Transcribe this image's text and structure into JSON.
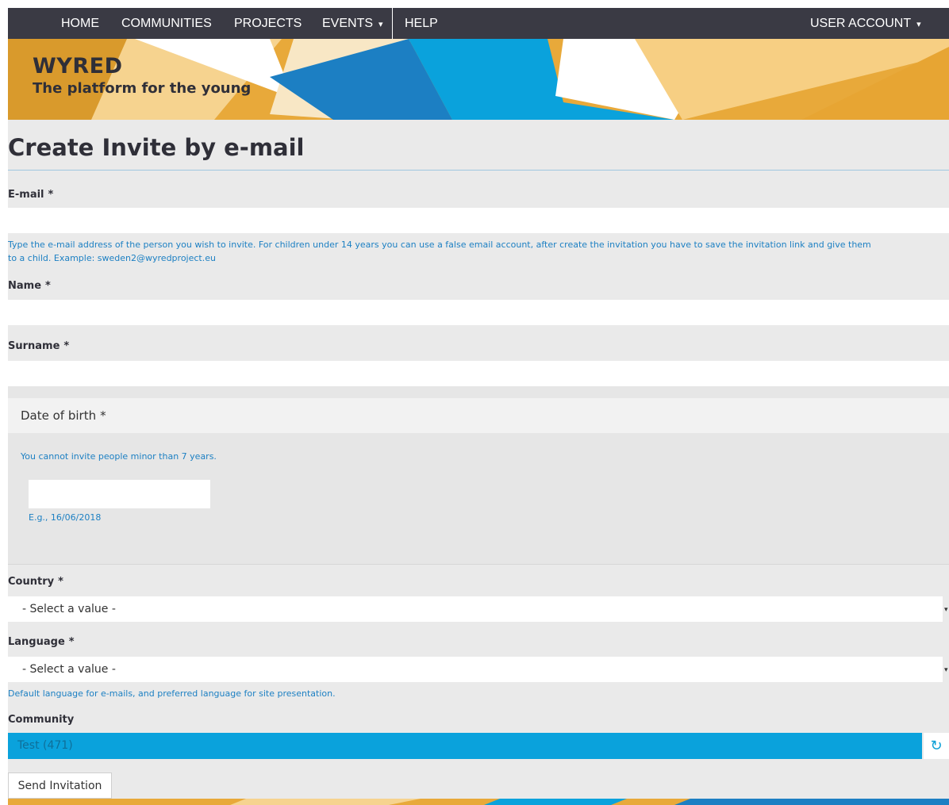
{
  "nav": {
    "home": "HOME",
    "communities": "COMMUNITIES",
    "projects": "PROJECTS",
    "events": "EVENTS",
    "help": "HELP",
    "user_account": "USER ACCOUNT",
    "caret": "▾"
  },
  "banner": {
    "title": "WYRED",
    "subtitle": "The platform for the young"
  },
  "page": {
    "title": "Create Invite by e-mail"
  },
  "form": {
    "email": {
      "label": "E-mail",
      "required": "*",
      "value": "",
      "help": "Type the e-mail address of the person you wish to invite. For children under 14 years you can use a false email account, after create the invitation you have to save the invitation link and give them",
      "help2": "to a child. Example: sweden2@wyredproject.eu"
    },
    "name": {
      "label": "Name",
      "required": "*",
      "value": ""
    },
    "surname": {
      "label": "Surname",
      "required": "*",
      "value": ""
    },
    "dob": {
      "label": "Date of birth",
      "required": "*",
      "note": "You cannot invite people minor than 7 years.",
      "value": "",
      "example": "E.g., 16/06/2018"
    },
    "country": {
      "label": "Country",
      "required": "*",
      "selected": "- Select a value -"
    },
    "language": {
      "label": "Language",
      "required": "*",
      "selected": "- Select a value -",
      "help": "Default language for e-mails, and preferred language for site presentation."
    },
    "community": {
      "label": "Community",
      "value": "Test (471)",
      "refresh_icon": "refresh-icon"
    },
    "submit": "Send Invitation"
  },
  "colors": {
    "nav_bg": "#3a3a44",
    "accent_blue": "#0aa2dc",
    "help_text": "#1d80c3",
    "banner_gold": "#e8a93a"
  }
}
